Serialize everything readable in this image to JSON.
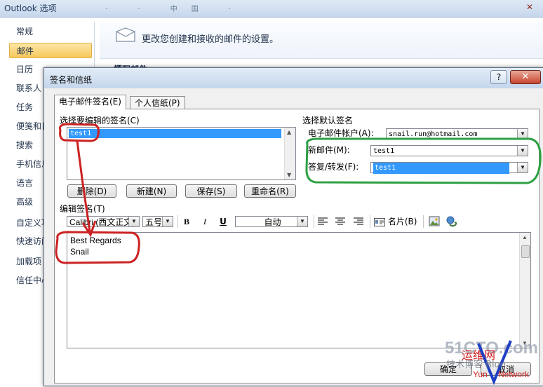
{
  "options_window": {
    "title": "Outlook 选项",
    "blurred_text": "· · 中国 ·",
    "close_glyph": "✕",
    "nav_items": [
      {
        "label": "常规"
      },
      {
        "label": "邮件",
        "selected": true
      },
      {
        "label": "日历"
      },
      {
        "label": "联系人"
      },
      {
        "label": "任务"
      },
      {
        "label": "便笺和日"
      },
      {
        "label": "搜索"
      },
      {
        "label": "手机信息"
      },
      {
        "label": "语言"
      },
      {
        "label": "高级"
      },
      {
        "label": "自定义功"
      },
      {
        "label": "快速访问"
      },
      {
        "label": "加载项"
      },
      {
        "label": "信任中心"
      }
    ],
    "header_text": "更改您创建和接收的邮件的设置。",
    "section_heading": "撰写邮件"
  },
  "dialog": {
    "title": "签名和信纸",
    "help_glyph": "?",
    "close_glyph": "✕",
    "tabs": [
      {
        "label": "电子邮件签名(E)",
        "active": true
      },
      {
        "label": "个人信纸(P)"
      }
    ],
    "select_label": "选择要编辑的签名(C)",
    "signatures": [
      "test1"
    ],
    "buttons": {
      "delete": "删除(D)",
      "new": "新建(N)",
      "save": "保存(S)",
      "rename": "重命名(R)"
    },
    "default_group_label": "选择默认签名",
    "account_label": "电子邮件帐户(A):",
    "account_value": "snail.run@hotmail.com",
    "new_messages_label": "新邮件(M):",
    "new_messages_value": "test1",
    "replies_label": "答复/转发(F):",
    "replies_value": "test1",
    "edit_label": "编辑签名(T)",
    "toolbar": {
      "font": "Calibri (西文正文)",
      "size": "五号",
      "bold": "B",
      "italic": "I",
      "underline": "U",
      "color": "自动",
      "business_card": "名片(B)"
    },
    "editor_lines": [
      "Best Regards",
      "Snail"
    ],
    "ok_label": "确定",
    "cancel_label": "取消"
  },
  "watermark": {
    "line1": "51CTO.com",
    "line2": "运维网",
    "line3": "Yun",
    "line4": "Network",
    "line5": "技术博客 Blog"
  },
  "colors": {
    "annotation_red": "#cc2222",
    "annotation_green": "#2ea043",
    "selection_blue": "#3399ff",
    "nav_selected": "#f7c95c"
  }
}
